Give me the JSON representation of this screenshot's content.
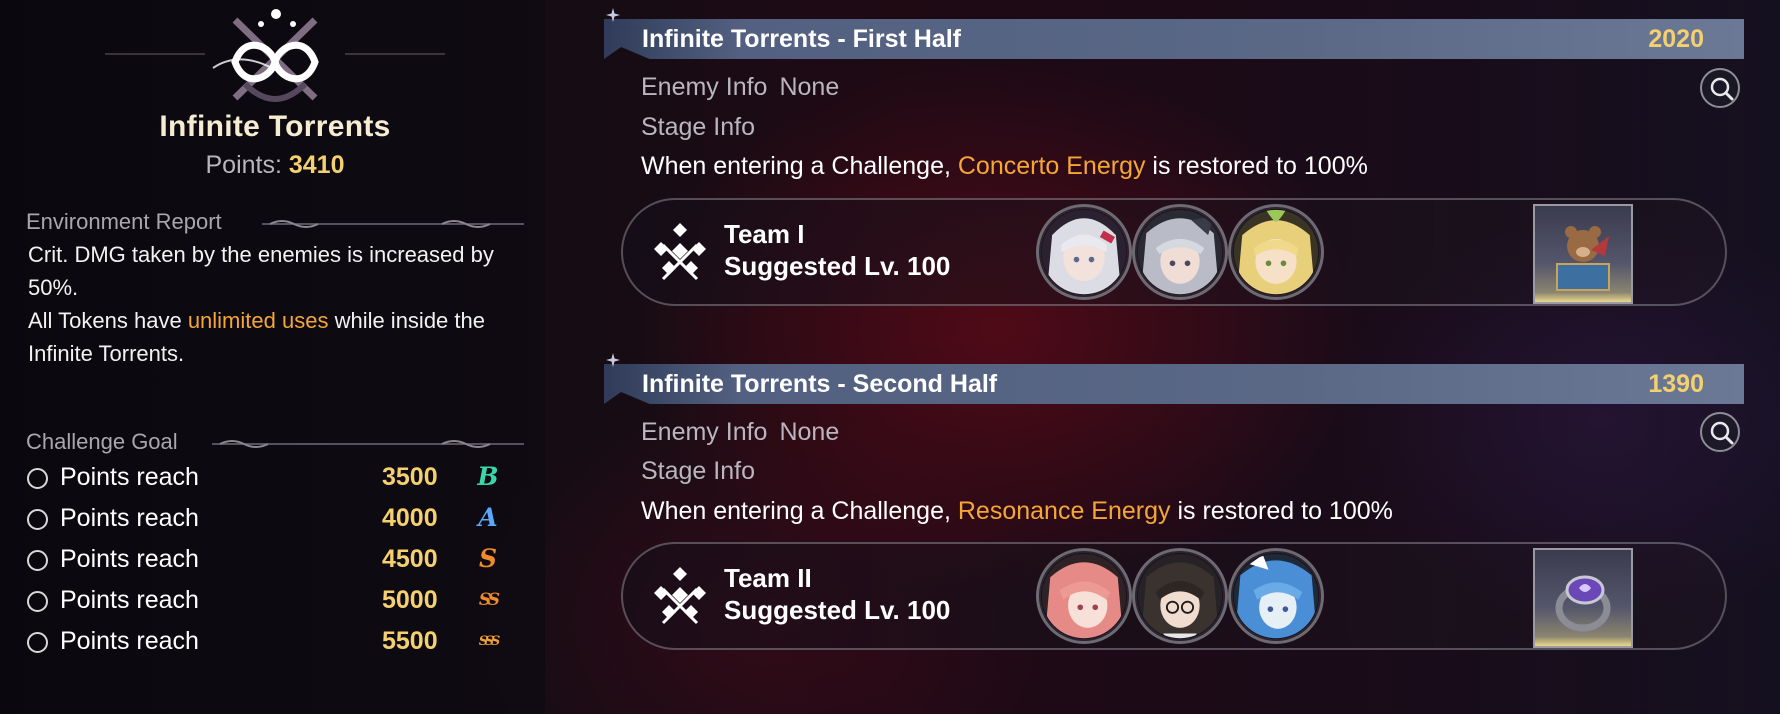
{
  "left": {
    "mode_title": "Infinite Torrents",
    "points_label": "Points:",
    "points_value": "3410",
    "environment_report_heading": "Environment Report",
    "environment_p1": "Crit. DMG taken by the enemies is increased by 50%.",
    "environment_p2_before": "All Tokens have ",
    "environment_p2_highlight": "unlimited uses",
    "environment_p2_after": " while inside the Infinite Torrents.",
    "challenge_goal_heading": "Challenge Goal",
    "goals": [
      {
        "label": "Points reach",
        "value": "3500",
        "grade": "B",
        "grade_color": "#39d6a8"
      },
      {
        "label": "Points reach",
        "value": "4000",
        "grade": "A",
        "grade_color": "#5aa8ff"
      },
      {
        "label": "Points reach",
        "value": "4500",
        "grade": "S",
        "grade_color": "#f08a2a"
      },
      {
        "label": "Points reach",
        "value": "5000",
        "grade": "SS",
        "grade_color": "#f08a2a"
      },
      {
        "label": "Points reach",
        "value": "5500",
        "grade": "SSS",
        "grade_color": "#f0a03a"
      }
    ]
  },
  "stages": [
    {
      "title": "Infinite Torrents - First Half",
      "score": "2020",
      "enemy_info_label": "Enemy Info",
      "enemy_info_value": "None",
      "stage_info_label": "Stage Info",
      "desc_before": "When entering a Challenge, ",
      "desc_highlight": "Concerto Energy",
      "desc_after": " is restored to 100%",
      "team_name": "Team I",
      "suggested_level": "Suggested Lv. 100",
      "members": [
        "white-haired-character-portrait",
        "silver-haired-character-portrait",
        "blonde-character-portrait"
      ],
      "echo": "teddy-bear-echo-icon"
    },
    {
      "title": "Infinite Torrents - Second Half",
      "score": "1390",
      "enemy_info_label": "Enemy Info",
      "enemy_info_value": "None",
      "stage_info_label": "Stage Info",
      "desc_before": "When entering a Challenge, ",
      "desc_highlight": "Resonance Energy",
      "desc_after": " is restored to 100%",
      "team_name": "Team II",
      "suggested_level": "Suggested Lv. 100",
      "members": [
        "pink-haired-character-portrait",
        "dark-haired-character-portrait",
        "blue-haired-character-portrait"
      ],
      "echo": "purple-ring-echo-icon"
    }
  ],
  "colors": {
    "accent_gold": "#f4d06f",
    "highlight_orange": "#f5a637",
    "banner_blue": "#56637f"
  }
}
